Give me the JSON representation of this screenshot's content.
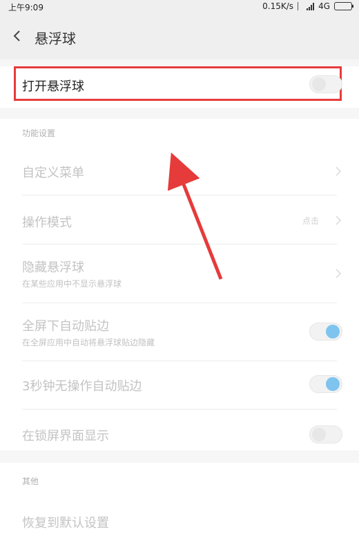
{
  "status_bar": {
    "time": "上午9:09",
    "net_speed": "0.15K/s",
    "network": "4G"
  },
  "header": {
    "title": "悬浮球"
  },
  "main_toggle": {
    "label": "打开悬浮球",
    "on": false
  },
  "sections": {
    "features_title": "功能设置",
    "other_title": "其他"
  },
  "items": [
    {
      "label": "自定义菜单"
    },
    {
      "label": "操作模式",
      "value": "点击"
    },
    {
      "label": "隐藏悬浮球",
      "subtitle": "在某些应用中不显示悬浮球"
    },
    {
      "label": "全屏下自动贴边",
      "subtitle": "在全屏应用中自动将悬浮球贴边隐藏",
      "on": true
    },
    {
      "label": "3秒钟无操作自动贴边",
      "on": true
    },
    {
      "label": "在锁屏界面显示",
      "on": false
    }
  ],
  "other_items": [
    {
      "label": "恢复到默认设置"
    }
  ],
  "colors": {
    "highlight_border": "#e63b3b",
    "arrow": "#e63b3b",
    "toggle_on": "#7ec4ef"
  }
}
